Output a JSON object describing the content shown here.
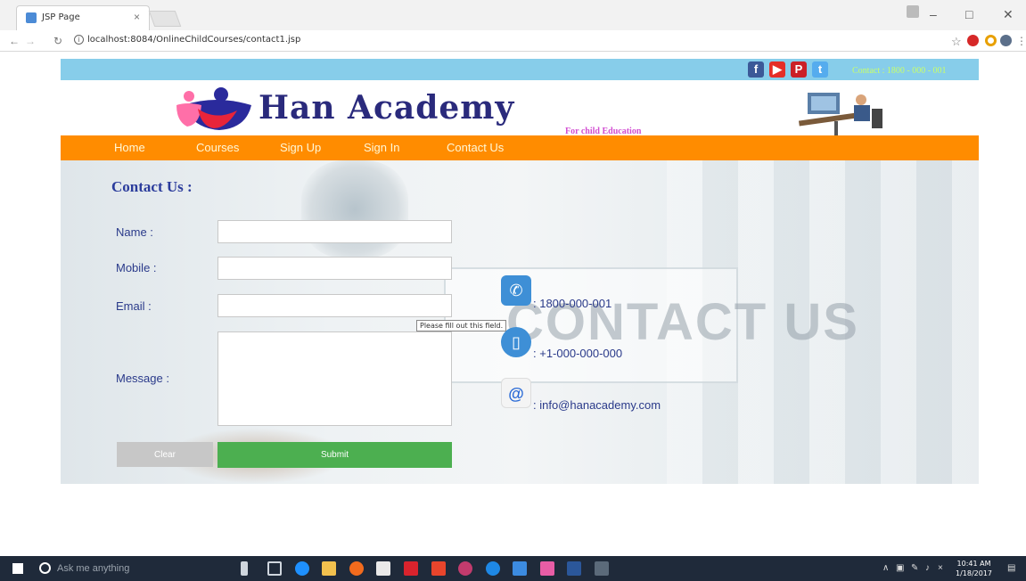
{
  "browser": {
    "tab_title": "JSP Page",
    "tab_close": "×",
    "url": "localhost:8084/OnlineChildCourses/contact1.jsp"
  },
  "site": {
    "topbar": {
      "contact": "Contact : 1800 - 000 - 001"
    },
    "logo_text": "Han Academy",
    "tagline": "For child Education",
    "nav": [
      "Home",
      "Courses",
      "Sign Up",
      "Sign In",
      "Contact Us"
    ]
  },
  "form": {
    "heading": "Contact Us :",
    "name_label": "Name :",
    "mobile_label": "Mobile :",
    "email_label": "Email :",
    "message_label": "Message :",
    "name_value": "",
    "mobile_value": "",
    "email_value": "",
    "validation_tooltip": "Please fill out this field.",
    "clear_label": "Clear",
    "submit_label": "Submit"
  },
  "contact_info": {
    "phone": ": 1800-000-001",
    "mobile": ": +1-000-000-000",
    "email": ": info@hanacademy.com",
    "background_text": "CONTACT US"
  },
  "taskbar": {
    "search_placeholder": "Ask me anything",
    "time": "10:41 AM",
    "date": "1/18/2017"
  },
  "colors": {
    "nav_orange": "#ff8c00",
    "top_strip": "#87cdea",
    "submit_green": "#4caf50",
    "heading_blue": "#2b3c9c"
  }
}
